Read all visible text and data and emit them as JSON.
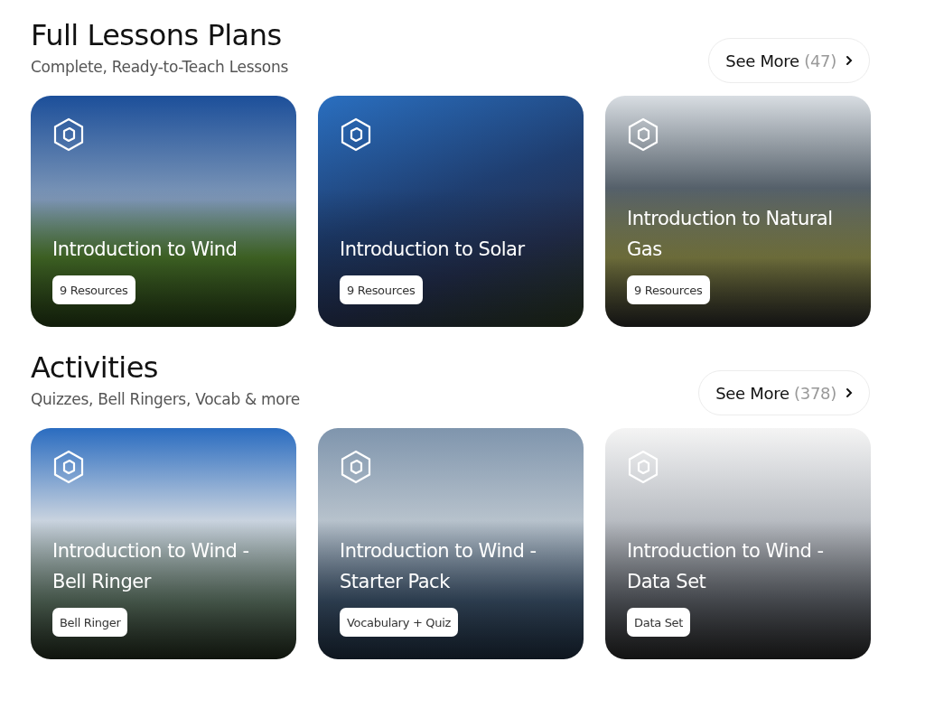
{
  "sections": [
    {
      "title": "Full Lessons Plans",
      "subtitle": "Complete, Ready-to-Teach Lessons",
      "see_more": {
        "label": "See More",
        "count": "(47)"
      },
      "cards": [
        {
          "title": "Introduction to Wind",
          "badge": "9 Resources"
        },
        {
          "title": "Introduction to Solar",
          "badge": "9 Resources"
        },
        {
          "title": "Introduction to Natural Gas",
          "badge": "9 Resources"
        }
      ]
    },
    {
      "title": "Activities",
      "subtitle": "Quizzes, Bell Ringers, Vocab & more",
      "see_more": {
        "label": "See More",
        "count": "(378)"
      },
      "cards": [
        {
          "title": "Introduction to Wind - Bell Ringer",
          "badge": "Bell Ringer"
        },
        {
          "title": "Introduction to Wind - Starter Pack",
          "badge": "Vocabulary + Quiz"
        },
        {
          "title": "Introduction to Wind - Data Set",
          "badge": "Data Set"
        }
      ]
    }
  ]
}
